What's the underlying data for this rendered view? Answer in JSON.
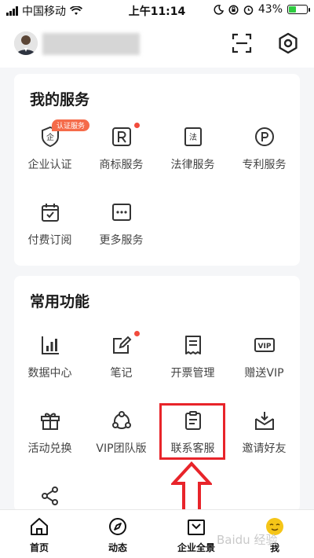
{
  "status_bar": {
    "carrier": "中国移动",
    "time": "上午11:14",
    "battery": "43%",
    "battery_level": 0.43
  },
  "header": {
    "icons": [
      "user-avatar",
      "scan-icon",
      "settings-icon"
    ]
  },
  "my_services": {
    "title": "我的服务",
    "items": [
      {
        "label": "企业认证",
        "icon": "shield-qi-icon",
        "badge": "认证服务"
      },
      {
        "label": "商标服务",
        "icon": "trademark-r-icon",
        "dot": true
      },
      {
        "label": "法律服务",
        "icon": "law-doc-icon"
      },
      {
        "label": "专利服务",
        "icon": "patent-circle-icon"
      },
      {
        "label": "付费订阅",
        "icon": "calendar-check-icon"
      },
      {
        "label": "更多服务",
        "icon": "more-dots-icon"
      }
    ]
  },
  "common_functions": {
    "title": "常用功能",
    "items": [
      {
        "label": "数据中心",
        "icon": "bar-chart-icon"
      },
      {
        "label": "笔记",
        "icon": "edit-note-icon",
        "dot": true
      },
      {
        "label": "开票管理",
        "icon": "receipt-icon"
      },
      {
        "label": "赠送VIP",
        "icon": "vip-ticket-icon"
      },
      {
        "label": "活动兑换",
        "icon": "gift-icon"
      },
      {
        "label": "VIP团队版",
        "icon": "team-triangle-icon"
      },
      {
        "label": "联系客服",
        "icon": "clipboard-icon"
      },
      {
        "label": "邀请好友",
        "icon": "invite-download-icon"
      },
      {
        "label": "",
        "icon": "share-icon"
      }
    ]
  },
  "tab_bar": {
    "tabs": [
      {
        "label": "首页",
        "icon": "home-icon"
      },
      {
        "label": "动态",
        "icon": "compass-icon"
      },
      {
        "label": "企业全景",
        "icon": "bag-icon"
      },
      {
        "label": "我",
        "icon": "me-face-icon"
      }
    ]
  },
  "colors": {
    "accent_red": "#e8242a",
    "badge_orange": "#f56b4a",
    "dot_red": "#f24b3c",
    "me_tab_yellow": "#f5c518"
  },
  "watermark": "Baidu 经验"
}
